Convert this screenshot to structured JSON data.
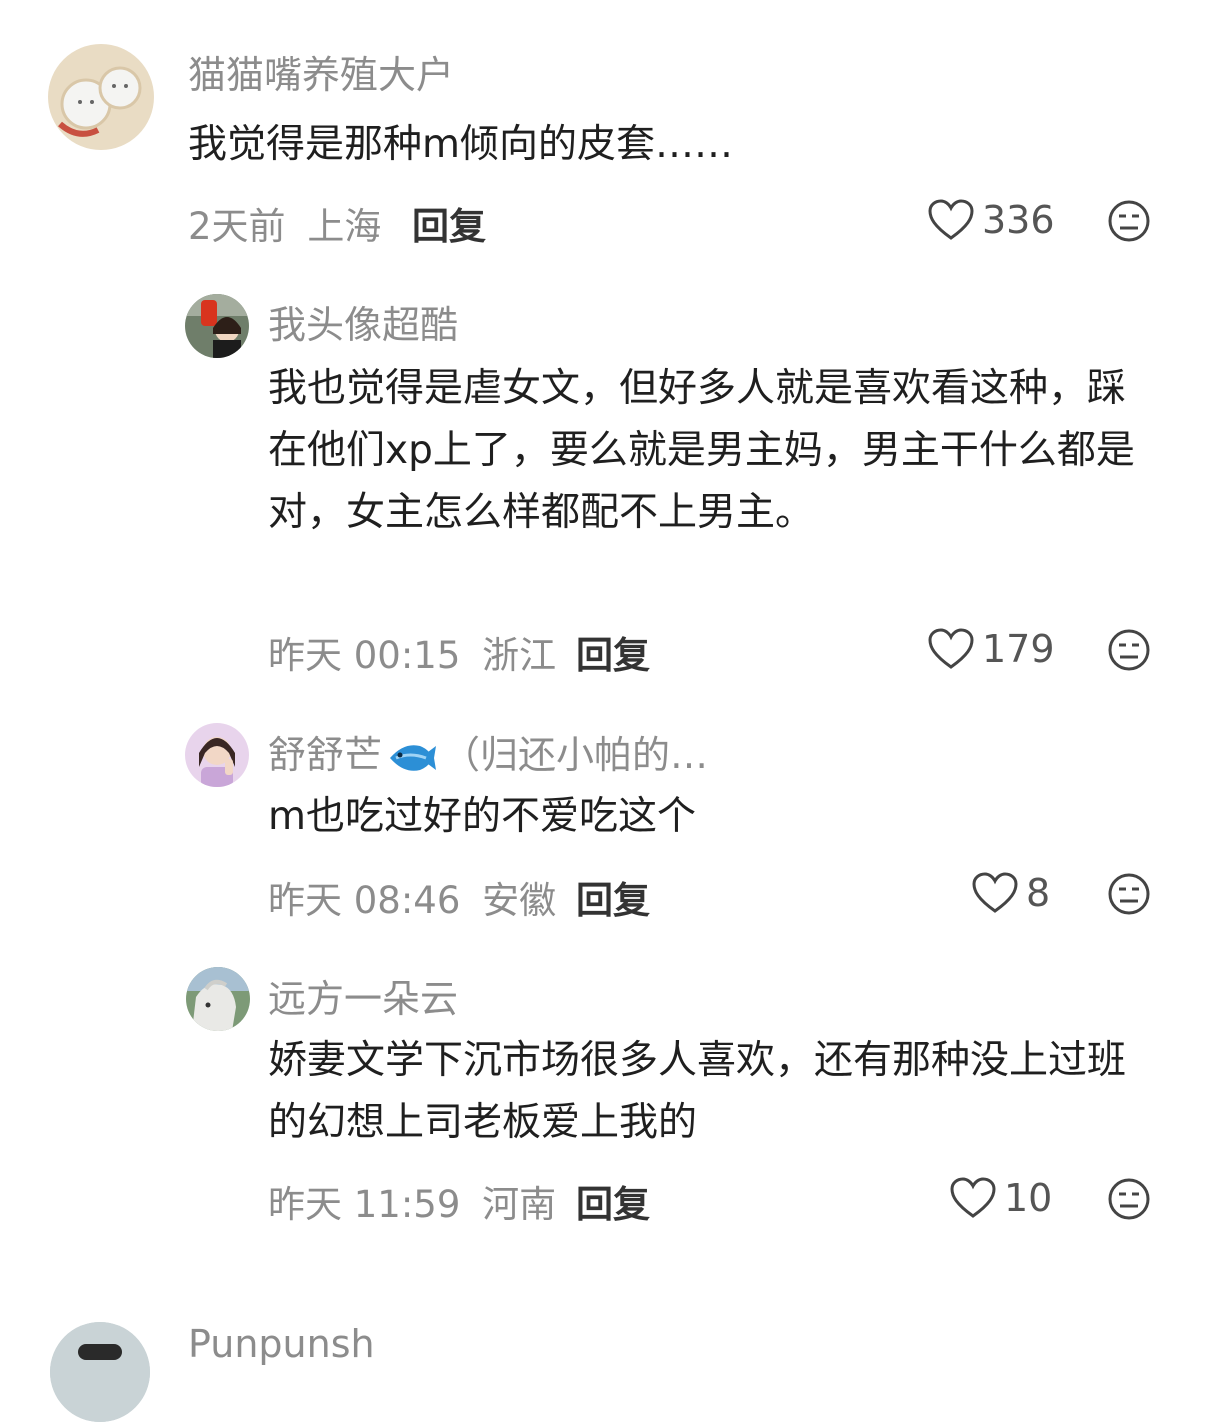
{
  "comments": [
    {
      "username": "猫猫嘴养殖大户",
      "text": "我觉得是那种m倾向的皮套……",
      "time": "2天前",
      "location": "上海",
      "reply_label": "回复",
      "likes": "336"
    },
    {
      "username": "我头像超酷",
      "text": "我也觉得是虐女文，但好多人就是喜欢看这种，踩在他们xp上了，要么就是男主妈，男主干什么都是对，女主怎么样都配不上男主。",
      "time": "昨天 00:15",
      "location": "浙江",
      "reply_label": "回复",
      "likes": "179"
    },
    {
      "username_prefix": "舒舒芒",
      "username_suffix": "（归还小帕的…",
      "text": "m也吃过好的不爱吃这个",
      "time": "昨天 08:46",
      "location": "安徽",
      "reply_label": "回复",
      "likes": "8"
    },
    {
      "username": "远方一朵云",
      "text": "娇妻文学下沉市场很多人喜欢，还有那种没上过班的幻想上司老板爱上我的",
      "time": "昨天 11:59",
      "location": "河南",
      "reply_label": "回复",
      "likes": "10"
    },
    {
      "username": "Punpunsh"
    }
  ],
  "icons": {
    "like": "heart-outline-icon",
    "dislike": "neutral-face-icon",
    "emoji": "fish-emoji"
  },
  "colors": {
    "secondary_text": "#8c8c8c",
    "primary_text": "#1f1f1f",
    "fish_blue": "#2c8fd6"
  }
}
